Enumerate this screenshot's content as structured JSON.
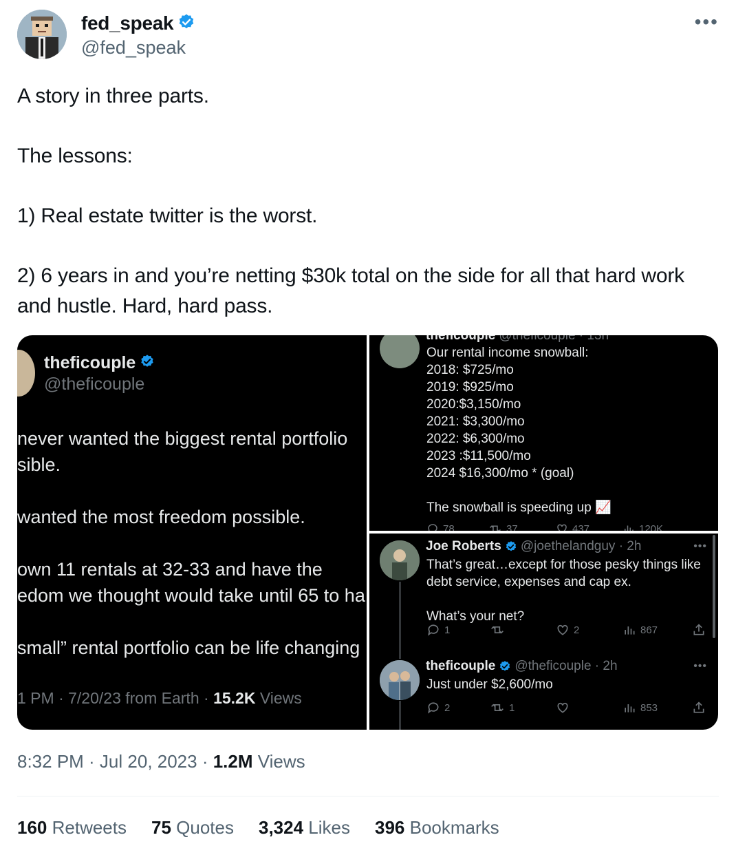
{
  "author": {
    "display_name": "fed_speak",
    "handle": "@fed_speak",
    "more_label": "•••"
  },
  "tweet": {
    "lines": [
      "A story in three parts.",
      "The lessons:",
      "1) Real estate twitter is the worst.",
      "2) 6 years in and you’re netting $30k total on the side for all that hard work and hustle. Hard, hard pass."
    ]
  },
  "media": {
    "left": {
      "display_name": "theficouple",
      "handle": "@theficouple",
      "lines": [
        "never wanted the biggest rental portfolio",
        "sible.",
        "wanted the most freedom possible.",
        "own 11 rentals at 32-33 and have the",
        "edom we thought would take until 65 to ha",
        "small” rental portfolio can be life changing"
      ],
      "meta_prefix": "1 PM · 7/20/23 from Earth · ",
      "meta_views_count": "15.2K",
      "meta_views_label": " Views"
    },
    "top_right": {
      "header_partial": "theficouple",
      "handle_partial": "@theficouple · 13h",
      "lines": [
        "Our rental income snowball:",
        "2018: $725/mo",
        "2019: $925/mo",
        "2020:$3,150/mo",
        "2021: $3,300/mo",
        "2022: $6,300/mo",
        "2023 :$11,500/mo",
        "2024 $16,300/mo * (goal)",
        "",
        "The snowball is speeding up"
      ],
      "chart_emoji": "📈",
      "stats": {
        "replies": "78",
        "retweets": "37",
        "likes": "437",
        "views": "120K"
      }
    },
    "bottom_right": {
      "reply1": {
        "display_name": "Joe Roberts",
        "handle": "@joethelandguy · 2h",
        "lines": [
          "That’s great…except for those pesky things like",
          "debt service, expenses and cap ex.",
          "",
          "What’s your net?"
        ],
        "stats": {
          "replies": "1",
          "retweets": "",
          "likes": "2",
          "views": "867"
        }
      },
      "reply2": {
        "display_name": "theficouple",
        "handle": "@theficouple · 2h",
        "lines": [
          "Just under $2,600/mo"
        ],
        "stats": {
          "replies": "2",
          "retweets": "1",
          "likes": "",
          "views": "853"
        }
      },
      "dots": "•••"
    }
  },
  "footer": {
    "time_date": "8:32 PM · Jul 20, 2023 · ",
    "views_count": "1.2M",
    "views_label": " Views",
    "stats": [
      {
        "count": "160",
        "label": " Retweets"
      },
      {
        "count": "75",
        "label": " Quotes"
      },
      {
        "count": "3,324",
        "label": " Likes"
      },
      {
        "count": "396",
        "label": " Bookmarks"
      }
    ]
  },
  "colors": {
    "verified": "#1d9bf0",
    "text": "#0f1419",
    "secondary": "#536471",
    "media_bg": "#000000"
  }
}
